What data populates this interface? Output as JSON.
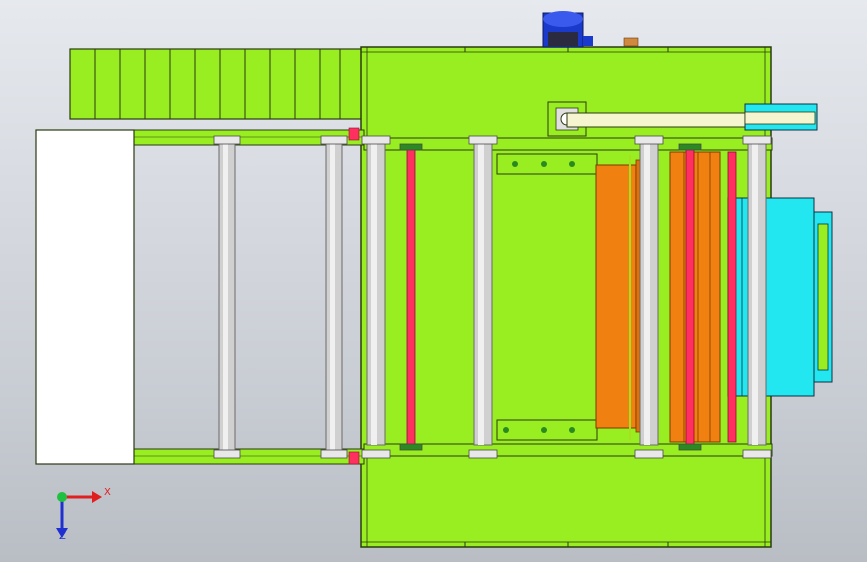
{
  "viewport": {
    "axis_x_label": "X",
    "axis_z_label": "Z"
  },
  "colors": {
    "frame": "#99ee22",
    "frame_edge": "#2a3a10",
    "roller": "#c8c8c8",
    "red_rod": "#ff3060",
    "orange": "#f08010",
    "cyan": "#22e6f0",
    "motor": "#1a3acc",
    "white_panel": "#ffffff",
    "background": "#d0d4da"
  },
  "icons": {
    "triad": "axis-triad-icon",
    "motor": "motor-icon"
  }
}
